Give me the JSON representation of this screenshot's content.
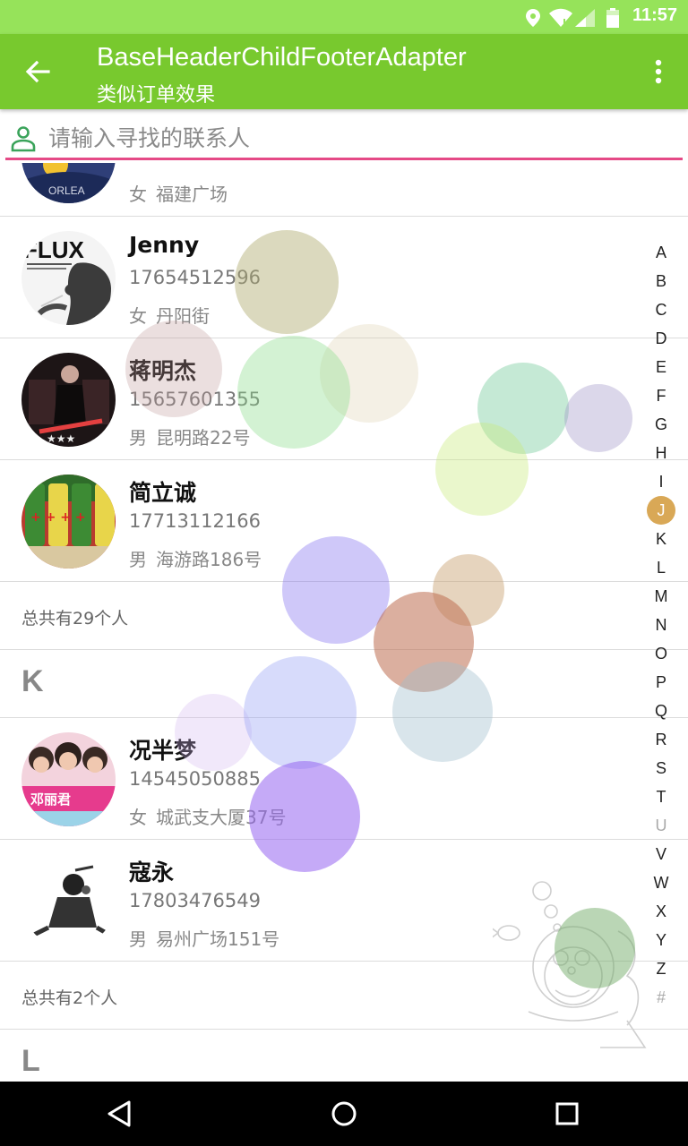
{
  "status_bar": {
    "time": "11:57",
    "icons": [
      "location-icon",
      "wifi-icon",
      "signal-icon",
      "battery-icon"
    ]
  },
  "app_bar": {
    "title": "BaseHeaderChildFooterAdapter",
    "subtitle": "类似订单效果",
    "back_icon": "arrow-back-icon",
    "menu_icon": "more-vert-icon"
  },
  "search": {
    "placeholder": "请输入寻找的联系人",
    "value": "",
    "icon": "person-outline-icon",
    "underline_color": "#e54a86"
  },
  "list": {
    "partial_top": {
      "sex": "女",
      "address": "福建广场"
    },
    "contacts": [
      {
        "name": "Jenny",
        "phone": "17654512596",
        "sex": "女",
        "address": "丹阳街"
      },
      {
        "name": "蒋明杰",
        "phone": "15657601355",
        "sex": "男",
        "address": "昆明路22号"
      },
      {
        "name": "简立诚",
        "phone": "17713112166",
        "sex": "男",
        "address": "海游路186号"
      }
    ],
    "footer_j": "总共有29个人",
    "header_k": "K",
    "contacts_k": [
      {
        "name": "况半梦",
        "phone": "14545050885",
        "sex": "女",
        "address": "城武支大厦37号"
      },
      {
        "name": "寇永",
        "phone": "17803476549",
        "sex": "男",
        "address": "易州广场151号"
      }
    ],
    "footer_k": "总共有2个人",
    "header_l": "L"
  },
  "index_bar": {
    "letters": [
      "A",
      "B",
      "C",
      "D",
      "E",
      "F",
      "G",
      "H",
      "I",
      "J",
      "K",
      "L",
      "M",
      "N",
      "O",
      "P",
      "Q",
      "R",
      "S",
      "T",
      "U",
      "V",
      "W",
      "X",
      "Y",
      "Z",
      "#"
    ],
    "selected": "J",
    "selected_color": "#d9a856"
  },
  "colors": {
    "status_bar": "#96e35a",
    "app_bar": "#78c92e",
    "accent": "#e54a86"
  },
  "nav_bar": {
    "icons": [
      "back-triangle-icon",
      "home-circle-icon",
      "recents-square-icon"
    ]
  }
}
